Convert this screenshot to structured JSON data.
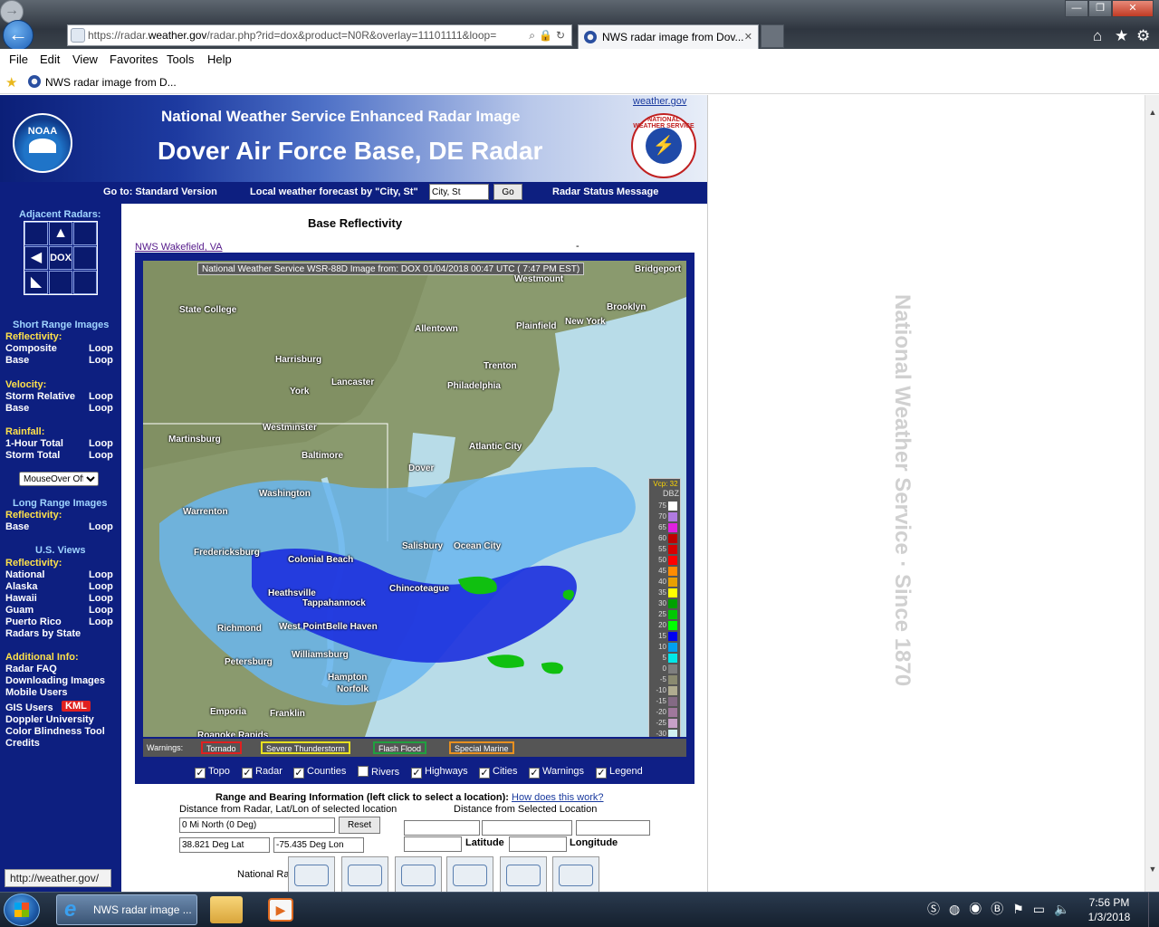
{
  "browser": {
    "url_prefix": "https://radar.",
    "url_domain": "weather.gov",
    "url_rest": "/radar.php?rid=dox&product=N0R&overlay=11101111&loop=",
    "tab_title": "NWS radar image from Dov...",
    "menu": [
      "File",
      "Edit",
      "View",
      "Favorites",
      "Tools",
      "Help"
    ],
    "favorite_label": "NWS radar image from D...",
    "status_url": "http://weather.gov/"
  },
  "header": {
    "line1": "National Weather Service Enhanced Radar Image",
    "line2": "Dover Air Force Base, DE Radar",
    "weather_link": "weather.gov",
    "noaa_label": "NOAA",
    "nws_ring": "NATIONAL WEATHER SERVICE"
  },
  "subnav": {
    "goto": "Go to: Standard Version",
    "local": "Local weather forecast by \"City, St\"",
    "city_value": "City, St",
    "go_label": "Go",
    "status": "Radar Status Message"
  },
  "sidebar": {
    "adjacent_title": "Adjacent Radars:",
    "center_label": "DOX",
    "short_range_title": "Short Range Images",
    "reflectivity_label": "Reflectivity:",
    "composite": "Composite",
    "base": "Base",
    "loop": "Loop",
    "velocity_label": "Velocity:",
    "storm_relative": "Storm Relative",
    "rainfall_label": "Rainfall:",
    "one_hour": "1-Hour Total",
    "storm_total": "Storm Total",
    "mouseover": "MouseOver Off",
    "long_range_title": "Long Range Images",
    "us_views_title": "U.S. Views",
    "national": "National",
    "alaska": "Alaska",
    "hawaii": "Hawaii",
    "guam": "Guam",
    "puerto_rico": "Puerto Rico",
    "radars_by_state": "Radars by State",
    "additional_label": "Additional Info:",
    "radar_faq": "Radar FAQ",
    "downloading": "Downloading Images",
    "mobile": "Mobile Users",
    "gis": "GIS Users",
    "kml": "KML",
    "doppler": "Doppler University",
    "color_blind": "Color Blindness Tool",
    "credits": "Credits"
  },
  "main": {
    "title": "Base Reflectivity",
    "neighbor_link": "NWS Wakefield, VA",
    "dash": "-",
    "caption": "National Weather Service WSR-88D Image from: DOX 01/04/2018 00:47 UTC ( 7:47 PM EST)",
    "cities": [
      "Bridgeport",
      "Westmount",
      "State College",
      "Allentown",
      "Plainfield",
      "New York",
      "Brooklyn",
      "Harrisburg",
      "Trenton",
      "York",
      "Lancaster",
      "Philadelphia",
      "Westminster",
      "Martinsburg",
      "Baltimore",
      "Atlantic City",
      "Dover",
      "Washington",
      "Warrenton",
      "Salisbury",
      "Ocean City",
      "Fredericksburg",
      "Colonial Beach",
      "Heathsville",
      "Chincoteague",
      "Tappahannock",
      "Richmond",
      "West Point",
      "Belle Haven",
      "Williamsburg",
      "Petersburg",
      "Hampton",
      "Norfolk",
      "Emporia",
      "Franklin",
      "Roanoke Rapids"
    ],
    "legend": {
      "vcp": "Vcp: 32",
      "unit": "DBZ",
      "levels": [
        "75",
        "70",
        "65",
        "60",
        "55",
        "50",
        "45",
        "40",
        "35",
        "30",
        "25",
        "20",
        "15",
        "10",
        "5",
        "0",
        "-5",
        "-10",
        "-15",
        "-20",
        "-25",
        "-30",
        "ND"
      ],
      "colors": [
        "#ffffff",
        "#b07ae0",
        "#e020e0",
        "#c00000",
        "#d80000",
        "#ff0000",
        "#ff8c00",
        "#e8a000",
        "#ffff00",
        "#00a000",
        "#00c800",
        "#00ff00",
        "#0000f0",
        "#00a0f0",
        "#00e8e8",
        "#7f7f7f",
        "#8a8a70",
        "#b0ac90",
        "#846a84",
        "#a0789c",
        "#c8a0c8",
        "#d0f0f0",
        "#999999"
      ]
    },
    "warnings_label": "Warnings:",
    "warnings": [
      {
        "label": "Tornado",
        "color": "#e02020"
      },
      {
        "label": "Severe Thunderstorm",
        "color": "#e8e020"
      },
      {
        "label": "Flash Flood",
        "color": "#20a040"
      },
      {
        "label": "Special Marine",
        "color": "#e89020"
      }
    ],
    "layers": [
      {
        "label": "Topo",
        "checked": "✓"
      },
      {
        "label": "Radar",
        "checked": "✓"
      },
      {
        "label": "Counties",
        "checked": "✓"
      },
      {
        "label": "Rivers",
        "checked": ""
      },
      {
        "label": "Highways",
        "checked": "✓"
      },
      {
        "label": "Cities",
        "checked": "✓"
      },
      {
        "label": "Warnings",
        "checked": "✓"
      },
      {
        "label": "Legend",
        "checked": "✓"
      }
    ]
  },
  "range": {
    "title": "Range and Bearing Information (left click to select a location):",
    "how_link": "How does this work?",
    "dist_radar": "Distance from Radar, Lat/Lon of selected location",
    "dist_selected": "Distance from Selected Location",
    "distance_value": "0 Mi North (0 Deg)",
    "reset": "Reset",
    "lat_value": "38.821 Deg Lat",
    "lon_value": "-75.435 Deg Lon",
    "latitude_label": "Latitude",
    "longitude_label": "Longitude",
    "national_label": "National Radar"
  },
  "watermark": "National Weather Service · Since 1870",
  "taskbar": {
    "ie_label": "NWS radar image ...",
    "time": "7:56 PM",
    "date": "1/3/2018"
  }
}
